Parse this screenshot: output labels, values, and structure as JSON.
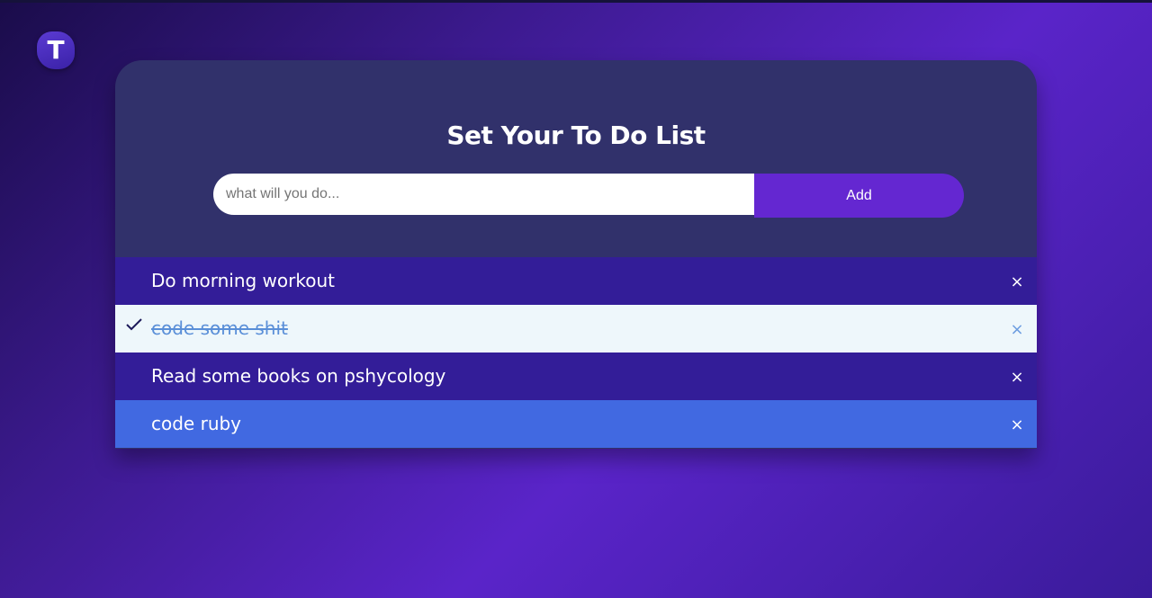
{
  "logo": {
    "letter": "T"
  },
  "header": {
    "title": "Set Your To Do List"
  },
  "form": {
    "input_value": "",
    "input_placeholder": "what will you do...",
    "add_label": "Add"
  },
  "tasks": [
    {
      "text": "Do morning workout",
      "state": "pending",
      "delete_icon": "×"
    },
    {
      "text": "code some shit",
      "state": "done",
      "delete_icon": "×"
    },
    {
      "text": "Read some books on pshycology",
      "state": "pending",
      "delete_icon": "×"
    },
    {
      "text": "code ruby",
      "state": "highlighted",
      "delete_icon": "×"
    }
  ],
  "colors": {
    "accent": "#6427d1",
    "card": "#31316b",
    "item_pending": "#331d98",
    "item_done": "#eef7fb",
    "item_highlight": "#4169e1"
  },
  "icons": {
    "check": "check-icon",
    "delete": "close-icon"
  }
}
